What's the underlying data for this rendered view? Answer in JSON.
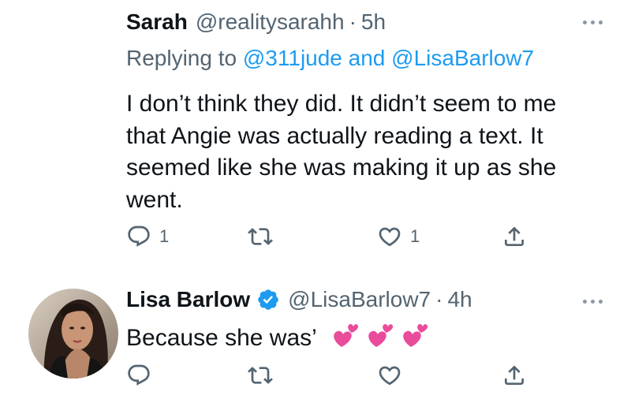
{
  "tweet1": {
    "name": "Sarah",
    "handle": "@realitysarahh",
    "time": "5h",
    "replying_prefix": "Replying to ",
    "mention1": "@311jude",
    "replying_and": " and ",
    "mention2": "@LisaBarlow7",
    "text": "I don’t think they did. It didn’t seem to me that Angie was actually reading a text. It seemed like she was making it up as she went.",
    "reply_count": "1",
    "like_count": "1"
  },
  "tweet2": {
    "name": "Lisa Barlow",
    "handle": "@LisaBarlow7",
    "time": "4h",
    "text": "Because she was’",
    "emoji": "heart-emoji"
  },
  "separator": "·",
  "icons": {
    "reply": "reply-icon",
    "retweet": "retweet-icon",
    "like": "like-icon",
    "share": "share-icon",
    "more": "more-icon",
    "verified": "verified-badge-icon"
  },
  "colors": {
    "text": "#0f1419",
    "secondary": "#536471",
    "link": "#1d9bf0",
    "verified": "#1d9bf0",
    "emoji_heart": "#e94c9a"
  }
}
